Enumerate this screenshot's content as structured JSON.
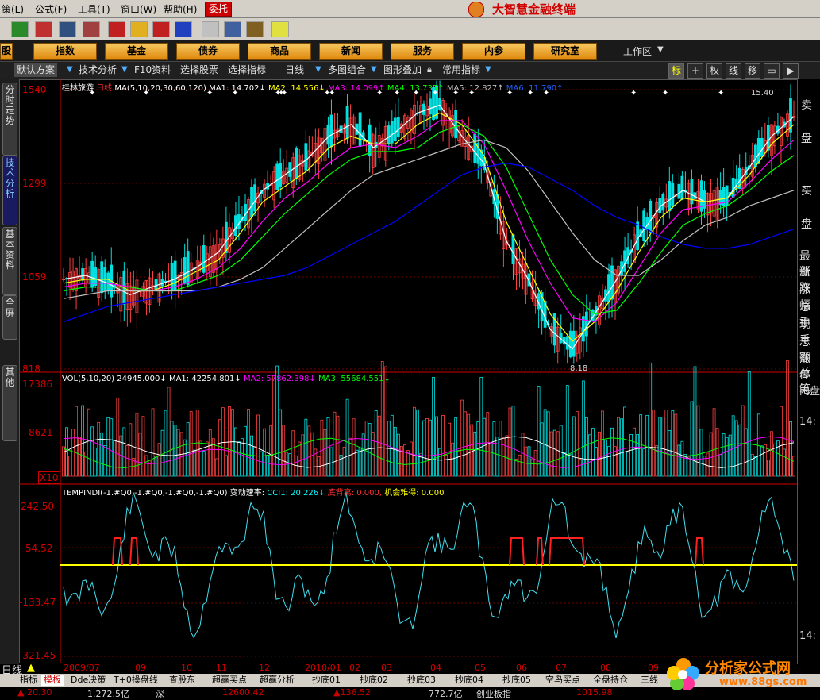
{
  "menu": {
    "items": [
      "策(",
      ")",
      "公式(L)",
      "工具(T)",
      "窗口(W)",
      "帮助(H)"
    ],
    "labels": [
      {
        "text": "策(L)"
      },
      {
        "text": "公式(F)"
      },
      {
        "text": "工具(T)"
      },
      {
        "text": "窗口(W)"
      },
      {
        "text": "帮助(H)"
      }
    ],
    "entrust": "委托",
    "brand": "大智慧金融终端"
  },
  "nav": {
    "buttons": [
      "股",
      "指数",
      "基金",
      "债券",
      "商品",
      "新闻",
      "服务",
      "内参",
      "研究室"
    ],
    "workzone": "工作区"
  },
  "subtabs": {
    "items": [
      "默认方案",
      "技术分析",
      "F10资料",
      "选择股票",
      "选择指标",
      "日线",
      "多图组合",
      "图形叠加",
      "常用指标"
    ],
    "right_buttons": [
      "标",
      "+",
      "权",
      "线",
      "移",
      "▭",
      "▶"
    ]
  },
  "sidebar": {
    "tabs": [
      "分时走势",
      "技术分析",
      "基本资料",
      "全屏",
      "其他"
    ]
  },
  "right_panel": {
    "items": [
      "卖",
      "盘",
      "买",
      "盘",
      "最新",
      "涨跌",
      "涨幅",
      "总手",
      "现手",
      "总额",
      "涨停",
      "总笔",
      "内盘",
      "14:",
      "14:"
    ]
  },
  "price_panel": {
    "stock": "桂林旅游",
    "period": "日线",
    "ma_params": "MA(5,10,20,30,60,120)",
    "ma_labels": [
      {
        "text": "MA1: 14.702↓",
        "color": "#ffffff"
      },
      {
        "text": "MA2: 14.556↓",
        "color": "#ffff00"
      },
      {
        "text": "MA3: 14.099↑",
        "color": "#ff00ff"
      },
      {
        "text": "MA4: 13.735↑",
        "color": "#00ff00"
      },
      {
        "text": "MA5: 12.827↑",
        "color": "#c0c0c0"
      },
      {
        "text": "MA6: 11.790↑",
        "color": "#0000ff"
      }
    ],
    "y_ticks": [
      "1540",
      "1299",
      "1059",
      "818"
    ],
    "high_label": "15.40",
    "low_label": "8.18"
  },
  "volume_panel": {
    "title": "VOL(5,10,20)",
    "value": "24945.000↓",
    "ma_labels": [
      {
        "text": "MA1: 42254.801↓",
        "color": "#ffffff"
      },
      {
        "text": "MA2: 57862.398↓",
        "color": "#ff00ff"
      },
      {
        "text": "MA3: 55684.551↓",
        "color": "#00ff00"
      }
    ],
    "y_ticks": [
      "17386",
      "8621"
    ],
    "unit": "X10"
  },
  "indicator_panel": {
    "title": "TEMPINDI(-1.#Q0,-1.#Q0,-1.#Q0,-1.#Q0)",
    "labels": [
      {
        "text": "变动速率:",
        "color": "#ffffff"
      },
      {
        "text": "CCI1: 20.226↓",
        "color": "#00ffff"
      },
      {
        "text": "底背离: 0.000,",
        "color": "#ff0000"
      },
      {
        "text": "机会难得: 0.000",
        "color": "#ffff00"
      }
    ],
    "y_ticks": [
      "242.50",
      "54.52",
      "-133.47",
      "-321.45"
    ]
  },
  "date_axis": [
    "2009/07",
    "09",
    "10",
    "11",
    "12",
    "2010/01",
    "02",
    "03",
    "04",
    "05",
    "06",
    "07",
    "08",
    "09"
  ],
  "bottom_tabs": {
    "mode": "日线",
    "items": [
      "指标",
      "模板",
      "Dde决策",
      "T+0操盘线",
      "查股东",
      "超赢买点",
      "超赢分析",
      "抄底01",
      "抄底02",
      "抄底03",
      "抄底04",
      "抄底05",
      "空鸟买点",
      "全盘持仓",
      "三线"
    ]
  },
  "status_bar": {
    "items": [
      "▲ 20.30",
      "1.272.5亿",
      "深",
      "12600.42",
      "▲136.52",
      "772.7亿",
      "创业板指",
      "1015.98"
    ]
  },
  "watermark": {
    "text": "分析家公式网",
    "url": "www.88gs.com"
  },
  "chart_data": [
    {
      "type": "line",
      "title": "桂林旅游 日线",
      "series": [
        {
          "name": "MA1",
          "color": "#ffffff",
          "values": [
            10.5,
            10.6,
            10.4,
            10.1,
            10.3,
            10.5,
            10.8,
            11.2,
            12.0,
            12.8,
            13.2,
            13.6,
            14.2,
            14.5,
            13.9,
            14.3,
            14.8,
            15.0,
            14.2,
            13.5,
            11.5,
            10.5,
            9.2,
            8.7,
            9.6,
            10.5,
            11.6,
            12.4,
            12.8,
            12.5,
            12.6,
            13.4,
            14.2,
            14.7
          ]
        },
        {
          "name": "MA2",
          "color": "#ffff00",
          "values": [
            10.4,
            10.5,
            10.5,
            10.2,
            10.2,
            10.4,
            10.7,
            11.0,
            11.7,
            12.5,
            12.9,
            13.3,
            13.9,
            14.2,
            14.0,
            14.0,
            14.5,
            14.8,
            14.5,
            13.7,
            12.0,
            10.8,
            9.6,
            8.9,
            9.4,
            10.2,
            11.2,
            12.1,
            12.6,
            12.5,
            12.6,
            13.2,
            14.0,
            14.5
          ]
        },
        {
          "name": "MA3",
          "color": "#ff00ff",
          "values": [
            10.3,
            10.4,
            10.4,
            10.3,
            10.2,
            10.3,
            10.5,
            10.8,
            11.3,
            12.0,
            12.6,
            13.0,
            13.5,
            13.9,
            14.0,
            13.9,
            14.2,
            14.6,
            14.6,
            14.0,
            12.8,
            11.5,
            10.4,
            9.5,
            9.4,
            9.9,
            10.8,
            11.7,
            12.3,
            12.4,
            12.5,
            13.0,
            13.6,
            14.1
          ]
        },
        {
          "name": "MA4",
          "color": "#00ff00",
          "values": [
            10.2,
            10.3,
            10.3,
            10.3,
            10.2,
            10.2,
            10.4,
            10.6,
            11.0,
            11.6,
            12.2,
            12.7,
            13.2,
            13.6,
            13.8,
            13.8,
            13.9,
            14.3,
            14.5,
            14.2,
            13.4,
            12.2,
            11.0,
            10.1,
            9.6,
            9.7,
            10.4,
            11.2,
            11.9,
            12.2,
            12.4,
            12.8,
            13.3,
            13.7
          ]
        },
        {
          "name": "MA5",
          "color": "#c0c0c0",
          "values": [
            10.0,
            10.1,
            10.2,
            10.2,
            10.2,
            10.2,
            10.2,
            10.3,
            10.5,
            10.8,
            11.3,
            11.8,
            12.3,
            12.8,
            13.2,
            13.4,
            13.6,
            13.8,
            14.0,
            14.1,
            13.9,
            13.3,
            12.5,
            11.7,
            11.0,
            10.6,
            10.6,
            11.0,
            11.5,
            11.9,
            12.1,
            12.4,
            12.6,
            12.8
          ]
        },
        {
          "name": "MA6",
          "color": "#0000ff",
          "values": [
            9.4,
            9.6,
            9.8,
            9.9,
            10.0,
            10.1,
            10.2,
            10.3,
            10.4,
            10.5,
            10.6,
            10.8,
            11.1,
            11.4,
            11.7,
            12.0,
            12.4,
            12.8,
            13.2,
            13.4,
            13.5,
            13.4,
            13.1,
            12.8,
            12.4,
            12.1,
            11.9,
            11.6,
            11.4,
            11.3,
            11.3,
            11.4,
            11.6,
            11.8
          ]
        }
      ],
      "ylim": [
        8.18,
        15.4
      ]
    }
  ]
}
